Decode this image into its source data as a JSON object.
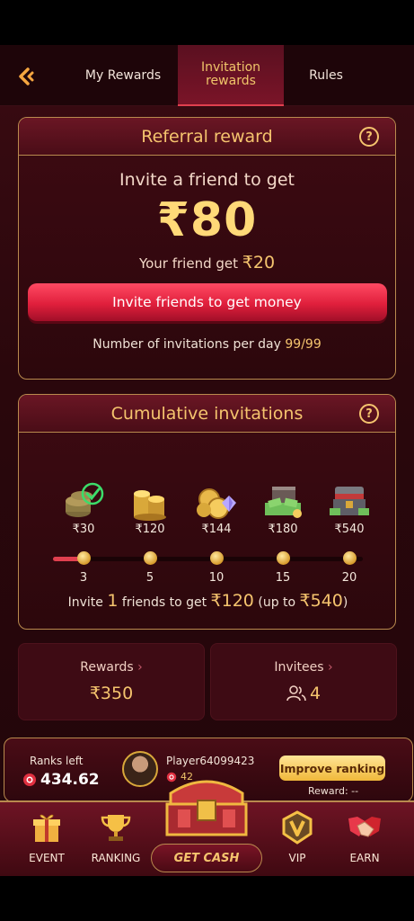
{
  "tabs": [
    {
      "label": "My Rewards"
    },
    {
      "label": "Invitation\nrewards"
    },
    {
      "label": "Rules"
    }
  ],
  "referral": {
    "title": "Referral reward",
    "subtitle": "Invite a friend to get",
    "amount": "₹80",
    "friend_prefix": "Your friend get ",
    "friend_amount": "₹20",
    "button": "Invite friends to get money",
    "per_day_label": "Number of invitations per day ",
    "per_day_value": "99/99"
  },
  "cumulative": {
    "title": "Cumulative invitations",
    "milestones": [
      {
        "reward": "₹30",
        "step": "3"
      },
      {
        "reward": "₹120",
        "step": "5"
      },
      {
        "reward": "₹144",
        "step": "10"
      },
      {
        "reward": "₹180",
        "step": "15"
      },
      {
        "reward": "₹540",
        "step": "20"
      }
    ],
    "progress": 0.1,
    "footer_invite": "Invite ",
    "footer_count": "1",
    "footer_mid": " friends to get ",
    "footer_amount": "₹120",
    "footer_upto": " (up to ",
    "footer_max": "₹540",
    "footer_close": ")"
  },
  "stats": {
    "rewards_label": "Rewards",
    "rewards_value": "₹350",
    "invitees_label": "Invitees",
    "invitees_value": "4"
  },
  "rank": {
    "ranks_left_label": "Ranks left",
    "ranks_left_value": "434.62",
    "player_name": "Player64099423",
    "player_score": "42",
    "improve_button": "Improve ranking",
    "reward_text": "Reward: --"
  },
  "nav": {
    "event": "EVENT",
    "ranking": "RANKING",
    "get_cash": "GET CASH",
    "vip": "VIP",
    "earn": "EARN"
  },
  "colors": {
    "accent": "#f5c46e",
    "button": "#e01f3c",
    "background": "#2a070c"
  }
}
